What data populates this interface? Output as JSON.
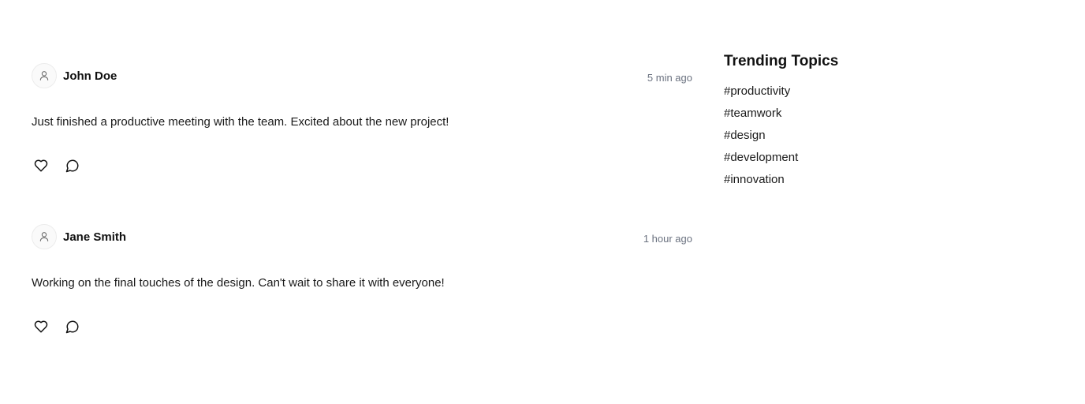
{
  "feed": {
    "posts": [
      {
        "author": "John Doe",
        "timestamp": "5 min ago",
        "content": "Just finished a productive meeting with the team. Excited about the new project!",
        "avatar_icon": "user-icon",
        "like_icon": "heart-icon",
        "comment_icon": "comment-icon"
      },
      {
        "author": "Jane Smith",
        "timestamp": "1 hour ago",
        "content": "Working on the final touches of the design. Can't wait to share it with everyone!",
        "avatar_icon": "user-icon",
        "like_icon": "heart-icon",
        "comment_icon": "comment-icon"
      }
    ]
  },
  "sidebar": {
    "title": "Trending Topics",
    "topics": [
      "#productivity",
      "#teamwork",
      "#design",
      "#development",
      "#innovation"
    ]
  },
  "colors": {
    "text": "#111111",
    "muted": "#6b7280",
    "avatar_border": "#ececec",
    "background": "#ffffff"
  }
}
